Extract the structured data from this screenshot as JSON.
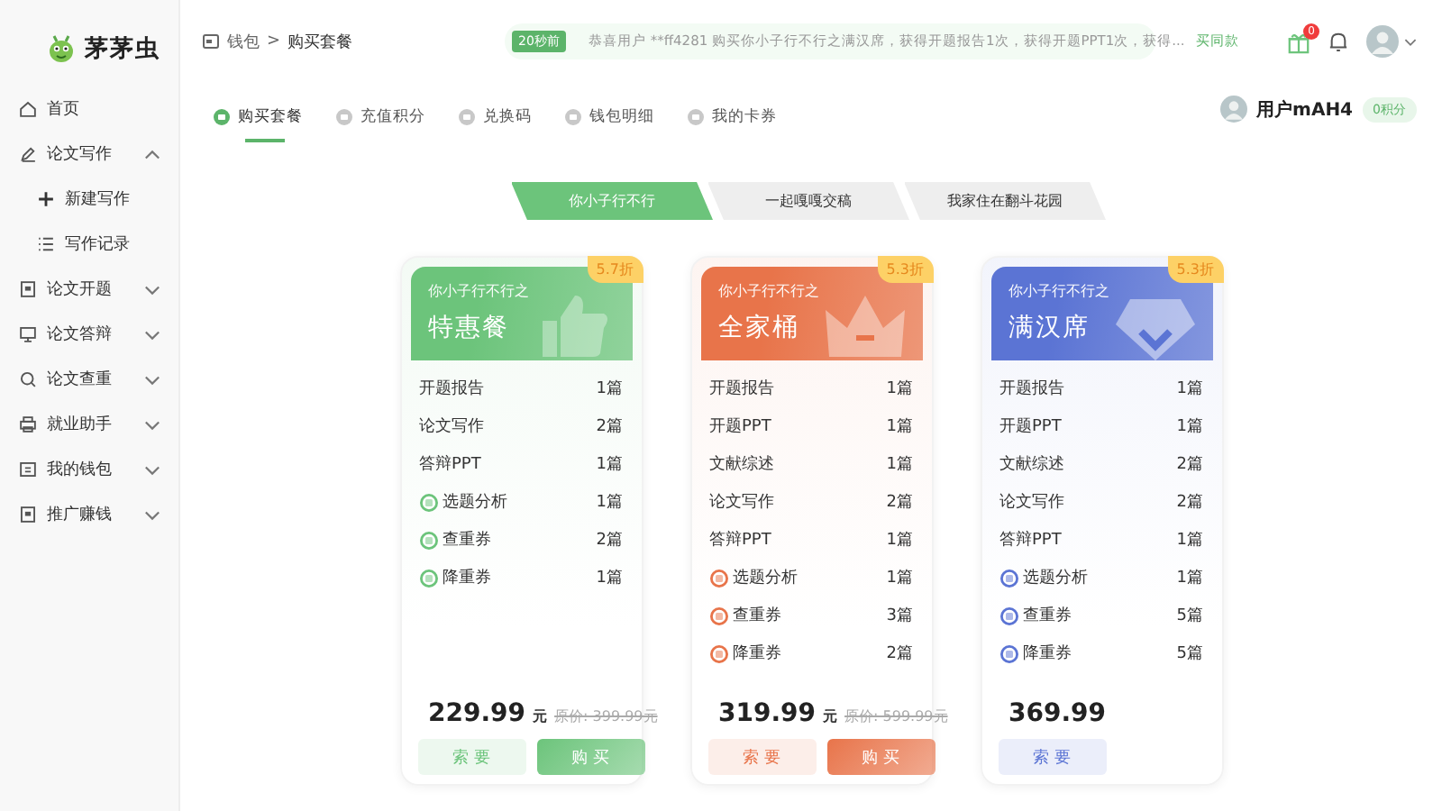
{
  "logo": {
    "text": "茅茅虫"
  },
  "sidebar": {
    "items": [
      {
        "label": "首页",
        "selected": false
      },
      {
        "label": "论文写作",
        "selected": false,
        "expanded": true,
        "children": [
          {
            "label": "新建写作",
            "selected": false
          },
          {
            "label": "写作记录",
            "selected": false
          }
        ]
      },
      {
        "label": "论文开题",
        "selected": false,
        "expanded": false
      },
      {
        "label": "论文答辩",
        "selected": false,
        "expanded": false
      },
      {
        "label": "论文查重",
        "selected": false,
        "expanded": false
      },
      {
        "label": "就业助手",
        "selected": false,
        "expanded": false
      },
      {
        "label": "我的钱包",
        "selected": false,
        "expanded": false
      },
      {
        "label": "推广赚钱",
        "selected": false,
        "expanded": false
      }
    ]
  },
  "header": {
    "breadcrumb": [
      "钱包",
      ">",
      "购买套餐"
    ],
    "notice": {
      "time": "20秒前",
      "text": "恭喜用户 **ff4281 购买你小子行不行之满汉席，获得开题报告1次，获得开题PPT1次，获得...",
      "link": "买同款"
    },
    "gift_count": "0"
  },
  "wallet_tabs": [
    {
      "label": "购买套餐",
      "selected": true
    },
    {
      "label": "充值积分",
      "selected": false
    },
    {
      "label": "兑换码",
      "selected": false
    },
    {
      "label": "钱包明细",
      "selected": false
    },
    {
      "label": "我的卡券",
      "selected": false
    }
  ],
  "user": {
    "name": "用户mAH4",
    "points": "0积分"
  },
  "package_tabs": [
    {
      "label": "你小子行不行",
      "selected": true
    },
    {
      "label": "一起嘎嘎交稿",
      "selected": false
    },
    {
      "label": "我家住在翻斗花园",
      "selected": false
    }
  ],
  "cards": [
    {
      "subtitle": "你小子行不行之",
      "title": "特惠餐",
      "discount": "5.7折",
      "color": "#6cc47b",
      "items": [
        {
          "kind": "plain",
          "name": "开题报告",
          "count": "1篇"
        },
        {
          "kind": "plain",
          "name": "论文写作",
          "count": "2篇"
        },
        {
          "kind": "plain",
          "name": "答辩PPT",
          "count": "1篇"
        },
        {
          "kind": "coupon",
          "name": "选题分析",
          "count": "1篇"
        },
        {
          "kind": "coupon",
          "name": "查重券",
          "count": "2篇"
        },
        {
          "kind": "coupon",
          "name": "降重券",
          "count": "1篇"
        }
      ],
      "price": "229.99",
      "unit": "元",
      "original_price": "原价: 399.99元",
      "buttons": [
        "索 要",
        "购 买"
      ]
    },
    {
      "subtitle": "你小子行不行之",
      "title": "全家桶",
      "discount": "5.3折",
      "color": "#e8744a",
      "items": [
        {
          "kind": "plain",
          "name": "开题报告",
          "count": "1篇"
        },
        {
          "kind": "plain",
          "name": "开题PPT",
          "count": "1篇"
        },
        {
          "kind": "plain",
          "name": "文献综述",
          "count": "1篇"
        },
        {
          "kind": "plain",
          "name": "论文写作",
          "count": "2篇"
        },
        {
          "kind": "plain",
          "name": "答辩PPT",
          "count": "1篇"
        },
        {
          "kind": "coupon",
          "name": "选题分析",
          "count": "1篇"
        },
        {
          "kind": "coupon",
          "name": "查重券",
          "count": "3篇"
        },
        {
          "kind": "coupon",
          "name": "降重券",
          "count": "2篇"
        }
      ],
      "price": "319.99",
      "unit": "元",
      "original_price": "原价: 599.99元",
      "buttons": [
        "索 要",
        "购 买"
      ]
    },
    {
      "subtitle": "你小子行不行之",
      "title": "满汉席",
      "discount": "5.3折",
      "color": "#5b74d4",
      "items": [
        {
          "kind": "plain",
          "name": "开题报告",
          "count": "1篇"
        },
        {
          "kind": "plain",
          "name": "开题PPT",
          "count": "1篇"
        },
        {
          "kind": "plain",
          "name": "文献综述",
          "count": "2篇"
        },
        {
          "kind": "plain",
          "name": "论文写作",
          "count": "2篇"
        },
        {
          "kind": "plain",
          "name": "答辩PPT",
          "count": "1篇"
        },
        {
          "kind": "coupon",
          "name": "选题分析",
          "count": "1篇"
        },
        {
          "kind": "coupon",
          "name": "查重券",
          "count": "5篇"
        },
        {
          "kind": "coupon",
          "name": "降重券",
          "count": "5篇"
        }
      ],
      "price": "369.99",
      "buttons": [
        "索 要"
      ]
    }
  ]
}
